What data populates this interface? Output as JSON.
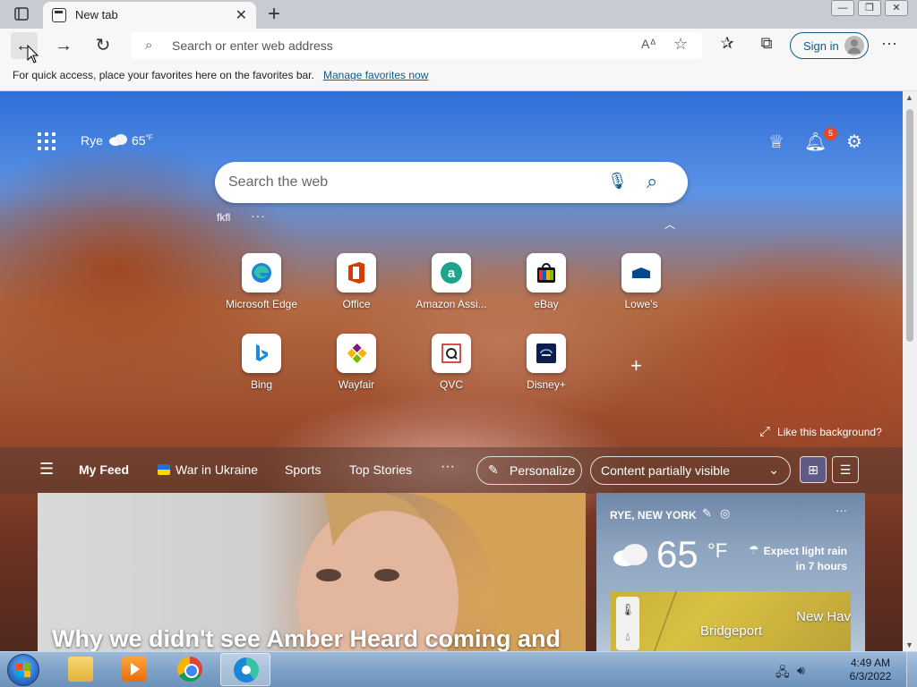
{
  "browser": {
    "tab": {
      "title": "New tab"
    },
    "address": {
      "placeholder": "Search or enter web address"
    },
    "signin_label": "Sign in",
    "favbar": {
      "message": "For quick access, place your favorites here on the favorites bar.",
      "link": "Manage favorites now"
    }
  },
  "newtab": {
    "location": "Rye",
    "temp": "65",
    "temp_unit": "°F",
    "notification_count": "5",
    "search_placeholder": "Search the web",
    "quicklinks_label": "fkfl",
    "tiles": [
      {
        "label": "Microsoft Edge",
        "icon": "edge-icon"
      },
      {
        "label": "Office",
        "icon": "office-icon"
      },
      {
        "label": "Amazon Assi...",
        "icon": "amazon-icon"
      },
      {
        "label": "eBay",
        "icon": "ebay-icon"
      },
      {
        "label": "Lowe's",
        "icon": "lowes-icon"
      },
      {
        "label": "Bing",
        "icon": "bing-icon"
      },
      {
        "label": "Wayfair",
        "icon": "wayfair-icon"
      },
      {
        "label": "QVC",
        "icon": "qvc-icon"
      },
      {
        "label": "Disney+",
        "icon": "disney-icon"
      }
    ],
    "like_background": "Like this background?",
    "feed": {
      "my_feed": "My Feed",
      "items": [
        "War in Ukraine",
        "Sports",
        "Top Stories"
      ],
      "more": "···",
      "personalize": "Personalize",
      "visibility": "Content partially visible"
    },
    "news_headline": "Why we didn't see Amber Heard coming and",
    "weather": {
      "city": "RYE, NEW YORK",
      "temp": "65",
      "unit": "°F",
      "forecast_line1": "Expect light rain",
      "forecast_line2": "in 7 hours",
      "map_labels": [
        "Bridgeport",
        "New Hav"
      ]
    }
  },
  "taskbar": {
    "time": "4:49 AM",
    "date": "6/3/2022"
  }
}
